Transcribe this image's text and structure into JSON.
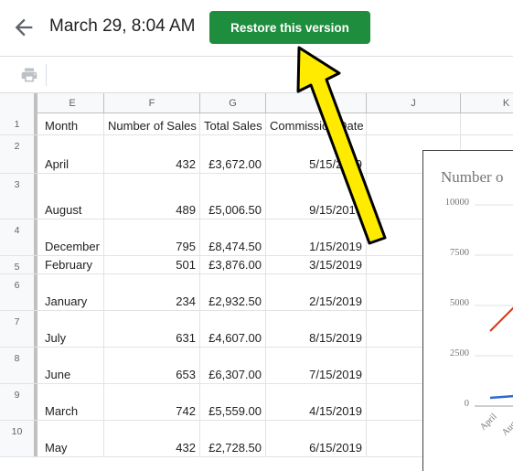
{
  "header": {
    "version_title": "March 29, 8:04 AM",
    "restore_label": "Restore this version"
  },
  "columns": [
    "E",
    "F",
    "G",
    "H",
    "J",
    "K"
  ],
  "rows": [
    {
      "num": "1",
      "month": "Month",
      "sales": "Number of Sales",
      "total": "Total Sales",
      "comm": "Commission Date"
    },
    {
      "num": "2",
      "month": "April",
      "sales": "432",
      "total": "£3,672.00",
      "comm": "5/15/2019"
    },
    {
      "num": "3",
      "month": "August",
      "sales": "489",
      "total": "£5,006.50",
      "comm": "9/15/2019"
    },
    {
      "num": "4",
      "month": "December",
      "sales": "795",
      "total": "£8,474.50",
      "comm": "1/15/2019"
    },
    {
      "num": "5",
      "month": "February",
      "sales": "501",
      "total": "£3,876.00",
      "comm": "3/15/2019"
    },
    {
      "num": "6",
      "month": "January",
      "sales": "234",
      "total": "£2,932.50",
      "comm": "2/15/2019"
    },
    {
      "num": "7",
      "month": "July",
      "sales": "631",
      "total": "£4,607.00",
      "comm": "8/15/2019"
    },
    {
      "num": "8",
      "month": "June",
      "sales": "653",
      "total": "£6,307.00",
      "comm": "7/15/2019"
    },
    {
      "num": "9",
      "month": "March",
      "sales": "742",
      "total": "£5,559.00",
      "comm": "4/15/2019"
    },
    {
      "num": "10",
      "month": "May",
      "sales": "432",
      "total": "£2,728.50",
      "comm": "6/15/2019"
    }
  ],
  "chart": {
    "title": "Number o",
    "y_ticks": [
      "10000",
      "7500",
      "5000",
      "2500",
      "0"
    ],
    "x_ticks": [
      "April",
      "Augu"
    ],
    "series_colors": {
      "red": "#dc3912",
      "blue": "#3366cc"
    }
  },
  "annotation": {
    "arrow_color": "#ffeb00"
  },
  "icons": {
    "back": "arrow-left-icon",
    "print": "print-icon"
  }
}
